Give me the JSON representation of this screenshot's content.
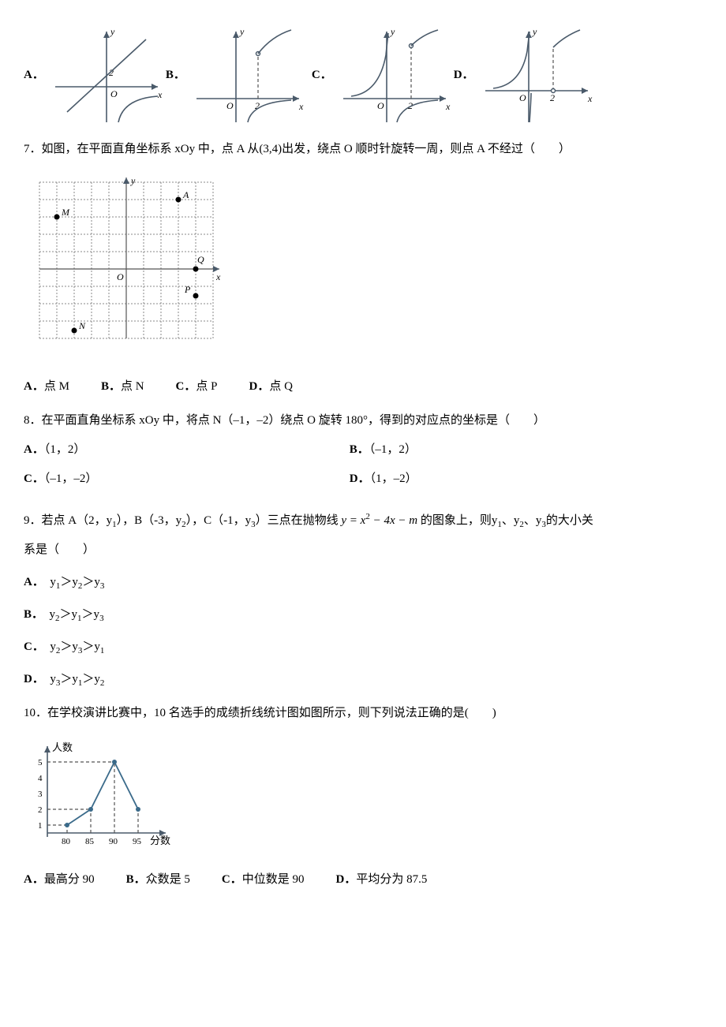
{
  "letters": {
    "A": "A．",
    "B": "B．",
    "C": "C．",
    "D": "D．"
  },
  "axis": {
    "x": "x",
    "y": "y",
    "O": "O"
  },
  "q6_graph": {
    "two": "2"
  },
  "q7": {
    "text_prefix": "7．如图，在平面直角坐标系 xOy 中，点 A 从",
    "coord": "(3,4)",
    "text_mid": "出发，绕点 O 顺时针旋转一周，则点 A 不经过（　　）",
    "grid": {
      "A": "A",
      "M": "M",
      "N": "N",
      "P": "P",
      "Q": "Q",
      "O": "O",
      "x": "x",
      "y": "y"
    },
    "opts": {
      "A": "点 M",
      "B": "点 N",
      "C": "点 P",
      "D": "点 Q"
    }
  },
  "q8": {
    "text": "8．在平面直角坐标系 xOy 中，将点 N（–1，–2）绕点 O 旋转 180°，得到的对应点的坐标是（　　）",
    "opts": {
      "A": "（1，2）",
      "B": "（–1，2）",
      "C": "（–1，–2）",
      "D": "（1，–2）"
    }
  },
  "q9": {
    "prefix": "9．若点 A（2，",
    "y1": "y",
    "mid1": "），B（-3，",
    "mid2": "），C（-1，",
    "mid3": "）三点在抛物线 ",
    "eq": "y = x",
    "eq2": " − 4x − m",
    "mid4": " 的图象上，则",
    "mid5": "、",
    "mid6": "、",
    "tail": "的大小关",
    "line2": "系是（　　）",
    "optA": "y₁＞y₂＞y₃",
    "optB": "y₂＞y₁＞y₃",
    "optC": "y₂＞y₃＞y₁",
    "optD": "y₃＞y₁＞y₂"
  },
  "q10": {
    "text": "10．在学校演讲比赛中，10 名选手的成绩折线统计图如图所示，则下列说法正确的是(　　)",
    "ylabel": "人数",
    "xlabel": "分数",
    "yticks": [
      "1",
      "2",
      "3",
      "4",
      "5"
    ],
    "xticks": [
      "80",
      "85",
      "90",
      "95"
    ],
    "opts": {
      "A": "最高分 90",
      "B": "众数是 5",
      "C": "中位数是 90",
      "D": "平均分为 87.5"
    }
  },
  "chart_data": {
    "type": "line",
    "title": "",
    "xlabel": "分数",
    "ylabel": "人数",
    "categories": [
      80,
      85,
      90,
      95
    ],
    "values": [
      1,
      2,
      5,
      2
    ],
    "ylim": [
      0,
      5
    ]
  }
}
